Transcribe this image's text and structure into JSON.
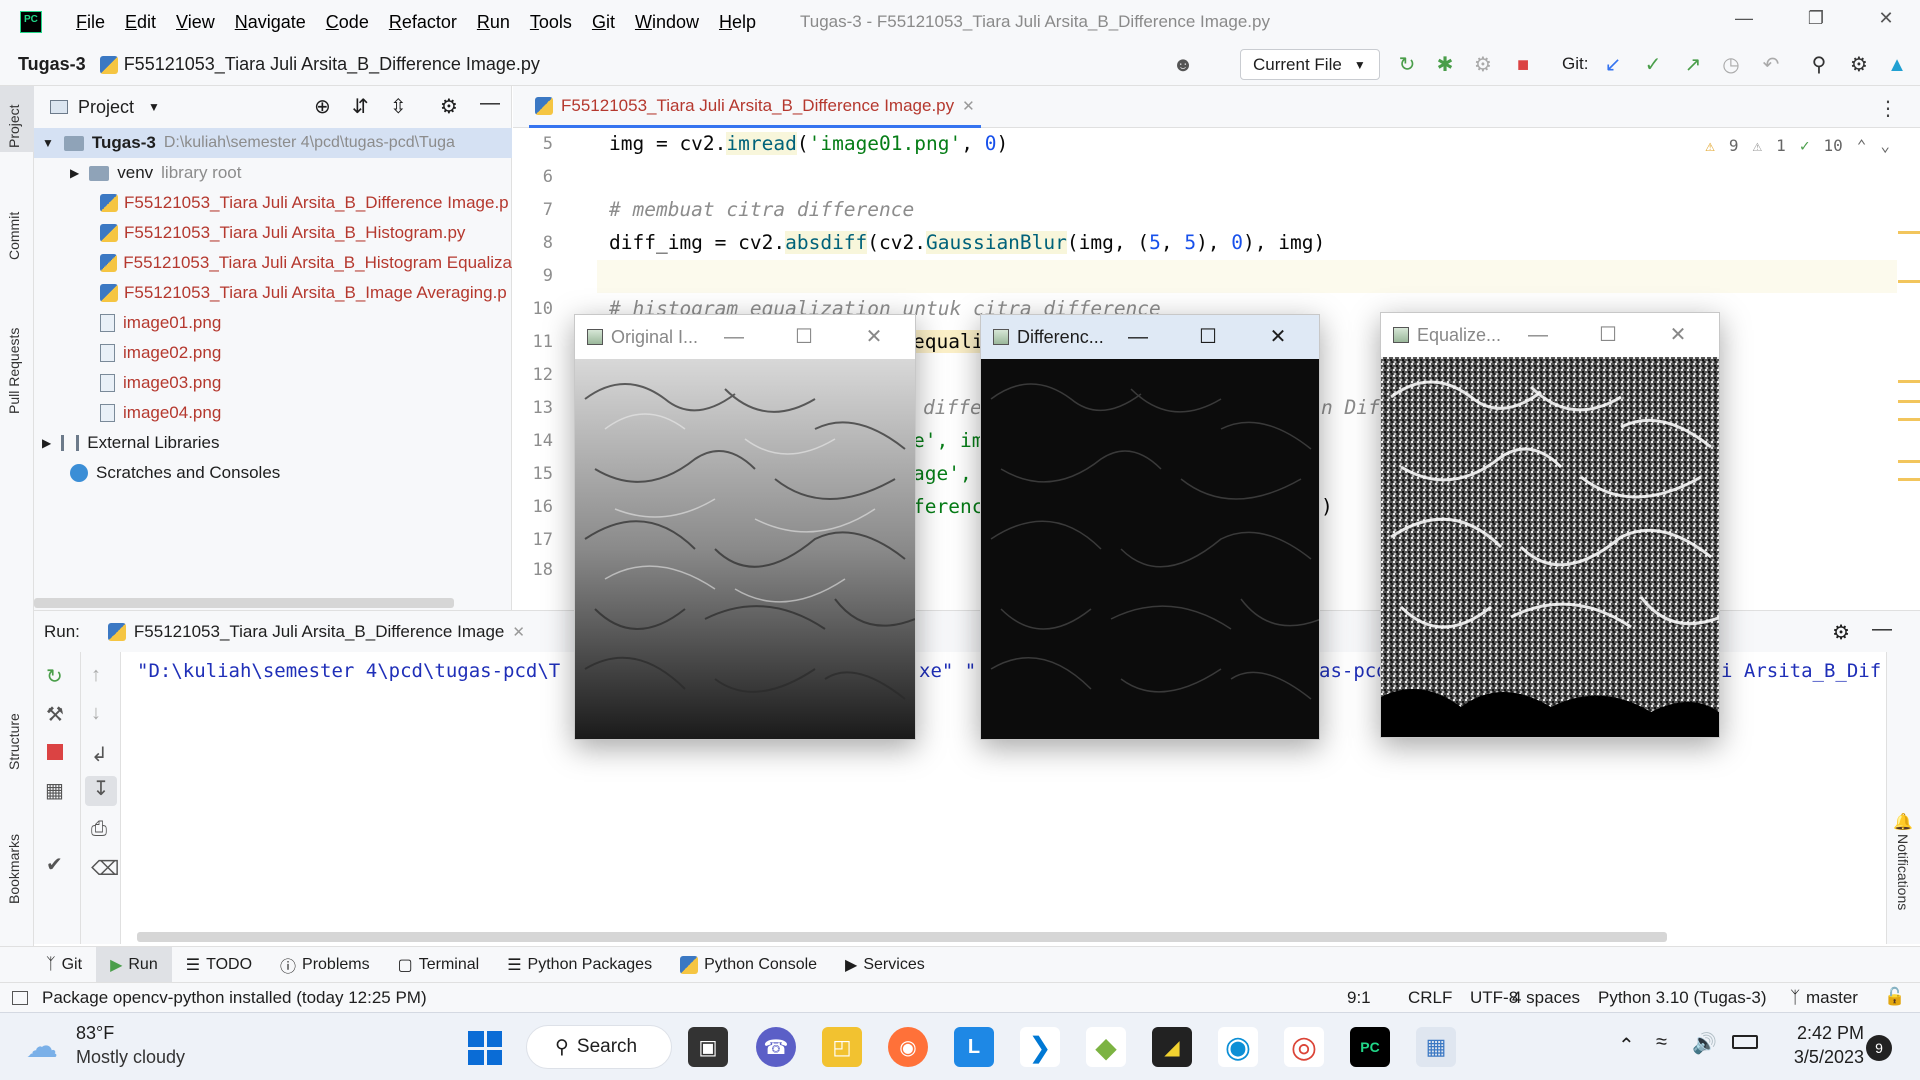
{
  "app": {
    "logo": "PC",
    "menu": [
      "File",
      "Edit",
      "View",
      "Navigate",
      "Code",
      "Refactor",
      "Run",
      "Tools",
      "Git",
      "Window",
      "Help"
    ],
    "window_title": "Tugas-3 - F55121053_Tiara Juli Arsita_B_Difference Image.py"
  },
  "nav": {
    "project": "Tugas-3",
    "file": "F55121053_Tiara Juli Arsita_B_Difference Image.py",
    "run_config": "Current File",
    "git_label": "Git:"
  },
  "sidebar_left": {
    "project": "Project",
    "commit": "Commit",
    "pull_requests": "Pull Requests",
    "structure": "Structure",
    "bookmarks": "Bookmarks"
  },
  "project": {
    "header": "Project",
    "root_name": "Tugas-3",
    "root_path": "D:\\kuliah\\semester 4\\pcd\\tugas-pcd\\Tuga",
    "venv": "venv",
    "venv_note": "library root",
    "files": [
      "F55121053_Tiara Juli Arsita_B_Difference Image.p",
      "F55121053_Tiara Juli Arsita_B_Histogram.py",
      "F55121053_Tiara Juli Arsita_B_Histogram Equaliza",
      "F55121053_Tiara Juli Arsita_B_Image Averaging.p"
    ],
    "images": [
      "image01.png",
      "image02.png",
      "image03.png",
      "image04.png"
    ],
    "external": "External Libraries",
    "scratches": "Scratches and Consoles"
  },
  "editor": {
    "tab": "F55121053_Tiara Juli Arsita_B_Difference Image.py",
    "warnings": "9",
    "weak_warnings": "1",
    "typos": "10",
    "line_numbers": [
      "5",
      "6",
      "7",
      "8",
      "9",
      "10",
      "11",
      "12",
      "13",
      "14",
      "15",
      "16",
      "17",
      "18"
    ],
    "line5_a": "img = cv2.",
    "line5_fn": "imread",
    "line5_b": "(",
    "line5_str": "'image01.png'",
    "line5_c": ", ",
    "line5_num": "0",
    "line5_d": ")",
    "line7": "# membuat citra difference",
    "line8_a": "diff_img = cv2.",
    "line8_fn1": "absdiff",
    "line8_b": "(cv2.",
    "line8_fn2": "GaussianBlur",
    "line8_c": "(img, (",
    "line8_n1": "5",
    "line8_d": ", ",
    "line8_n2": "5",
    "line8_e": "), ",
    "line8_n3": "0",
    "line8_f": "), img)",
    "line10": "# histogram equalization untuk citra difference",
    "frag11": "equali",
    "frag13a": "diffe",
    "frag13b": "n Dif",
    "frag14": "e', im",
    "frag15": "age',",
    "frag16a": "ferenc",
    "frag16b": ")"
  },
  "run": {
    "label": "Run:",
    "tab": "F55121053_Tiara Juli Arsita_B_Difference Image",
    "output_a": "\"D:\\kuliah\\semester 4\\pcd\\tugas-pcd\\T",
    "output_b": "xe\" \"",
    "output_c": "as-pcd",
    "output_d": "i Arsita_B_Dif"
  },
  "tool_windows": [
    "Git",
    "Run",
    "TODO",
    "Problems",
    "Terminal",
    "Python Packages",
    "Python Console",
    "Services"
  ],
  "status": {
    "message": "Package opencv-python installed (today 12:25 PM)",
    "position": "9:1",
    "line_sep": "CRLF",
    "encoding": "UTF-8",
    "indent": "4 spaces",
    "interpreter": "Python 3.10 (Tugas-3)",
    "branch": "master",
    "notifications": "Notifications"
  },
  "cv_windows": {
    "original": "Original I...",
    "difference": "Differenc...",
    "equalized": "Equalize..."
  },
  "taskbar": {
    "temp": "83°F",
    "weather": "Mostly cloudy",
    "search": "Search",
    "time": "2:42 PM",
    "date": "3/5/2023",
    "badge": "9"
  }
}
